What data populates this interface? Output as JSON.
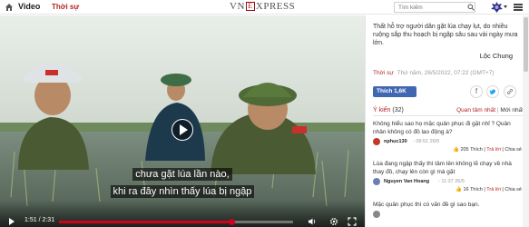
{
  "header": {
    "section": "Video",
    "subsection": "Thời sự",
    "logo_left": "VN",
    "logo_mid": "E",
    "logo_right": "XPRESS",
    "search_placeholder": "Tìm kiếm",
    "icons": [
      "home-icon",
      "search-icon",
      "avatar-icon",
      "menu-icon"
    ]
  },
  "video": {
    "subtitle_line1": "chưa gặt lúa lần nào,",
    "subtitle_line2": "khi ra đây nhìn thấy lúa bị ngập",
    "time": "1:51 / 2:31",
    "progress": 0.735,
    "accent": "#d0021b",
    "control_icons": [
      "play-icon",
      "volume-icon",
      "settings-icon",
      "fullscreen-icon"
    ]
  },
  "article": {
    "description": "Thất hỗ trợ người dân gặt lúa chạy lụt, do nhiều ruộng sắp thu hoạch bị ngập sâu sau vài ngày mưa lớn.",
    "author": "Lộc Chung",
    "category": "Thời sự",
    "datetime": "Thứ năm, 26/5/2022, 07:22 (GMT+7)",
    "like_label": "Thích 1,6K",
    "share_icons": [
      "facebook-icon",
      "twitter-icon",
      "link-icon"
    ]
  },
  "comments": {
    "title": "Ý kiến",
    "count": "(32)",
    "sort_active": "Quan tâm nhất",
    "sort_sep": "|",
    "sort_other": "Mới nhất",
    "items": [
      {
        "text": "Không hiểu sao họ mặc quân phục đi gặt nhỉ ? Quân nhân không có đồ lao động à?",
        "name": "nphuc130",
        "time": "- 09:51 26/5",
        "likes": "205",
        "like_label": "Thích",
        "reply": "Trả lời",
        "share": "Chia sẻ"
      },
      {
        "text": "Lúa đang ngập thấy thì tâm lên không lẽ chạy về nhà thay đồ, chạy lên còn gì mà gặt",
        "name": "Nguyen Van Hoang",
        "time": "- 11:37 26/5",
        "likes": "16",
        "like_label": "Thích",
        "reply": "Trả lời",
        "share": "Chia sẻ"
      },
      {
        "text": "Mặc quân phục thì có vấn đề gì sao bạn."
      }
    ]
  }
}
